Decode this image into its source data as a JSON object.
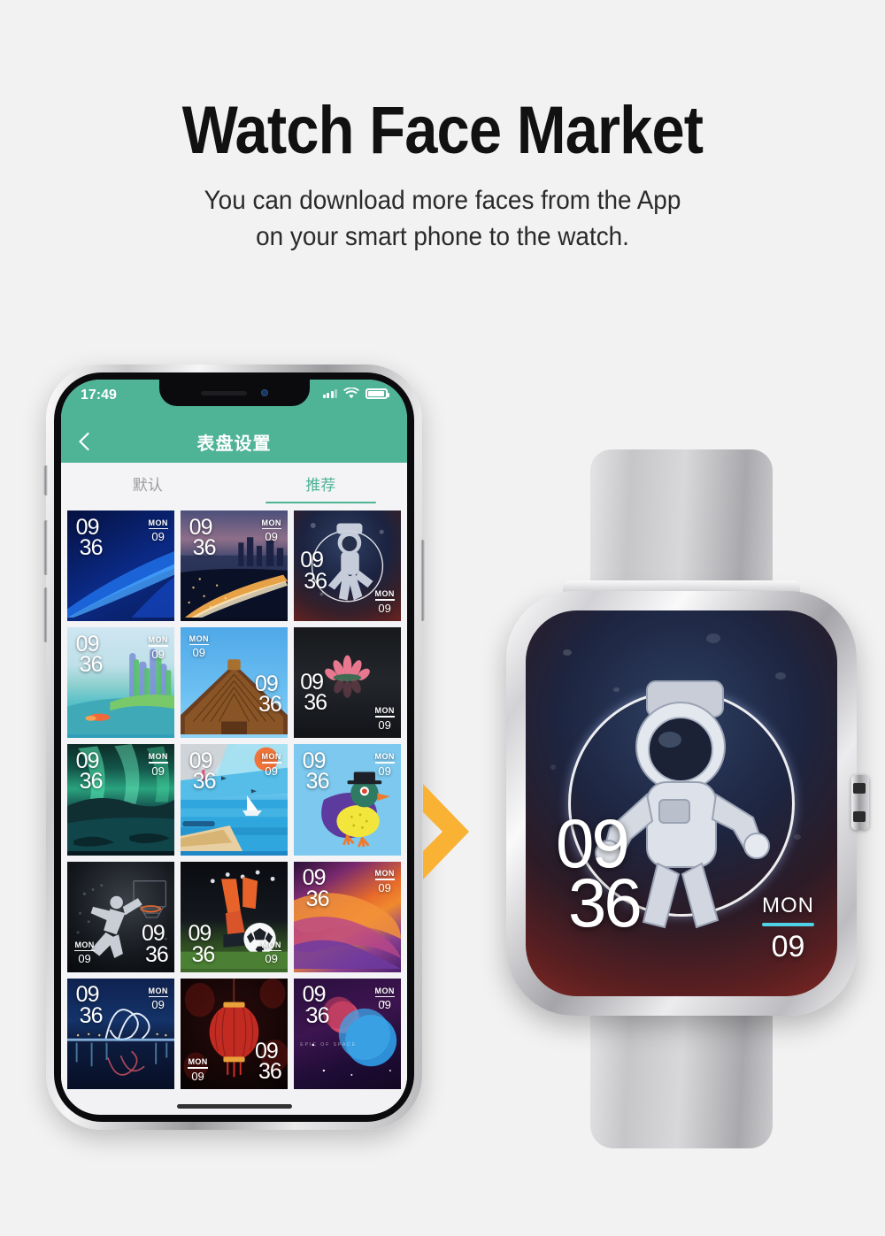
{
  "hero": {
    "title": "Watch Face Market",
    "subtitle_line1": "You can download more faces from the App",
    "subtitle_line2": "on your smart phone to the watch."
  },
  "colors": {
    "page_background": "#f2f2f2",
    "header_green": "#4fb396",
    "arrow_orange": "#f9b233",
    "date_accent_cyan": "#4fd2e6",
    "tab_inactive": "#9b9ba0"
  },
  "phone": {
    "status_bar": {
      "time": "17:49",
      "icons": [
        "signal-icon",
        "wifi-icon",
        "battery-icon"
      ],
      "battery_level": "86"
    },
    "navbar": {
      "back_icon": "chevron-left-icon",
      "title": "表盘设置"
    },
    "tabs": [
      {
        "label": "默认",
        "active": false
      },
      {
        "label": "推荐",
        "active": true
      }
    ],
    "home_indicator": "home-bar"
  },
  "watch_faces": {
    "time_hours": "09",
    "time_minutes": "36",
    "date_weekday": "MON",
    "date_day": "09",
    "tiles": [
      {
        "name": "blue-abstract-waves",
        "time_pos": "tl",
        "date_pos": "tr"
      },
      {
        "name": "city-night-skyline",
        "time_pos": "tl",
        "date_pos": "tr"
      },
      {
        "name": "astronaut-space",
        "time_pos": "ml",
        "date_pos": "br"
      },
      {
        "name": "fantasy-green-island",
        "time_pos": "tl",
        "date_pos": "tr"
      },
      {
        "name": "temple-roof-blue-sky",
        "time_pos": "mr",
        "date_pos": "tl"
      },
      {
        "name": "pink-lotus-dark",
        "time_pos": "cl",
        "date_pos": "br"
      },
      {
        "name": "aurora-northern-lights",
        "time_pos": "tl",
        "date_pos": "tr"
      },
      {
        "name": "sailboat-beach-flat",
        "time_pos": "tl",
        "date_pos": "tr"
      },
      {
        "name": "bird-top-hat-illustration",
        "time_pos": "tl",
        "date_pos": "tr"
      },
      {
        "name": "basketball-dunk",
        "time_pos": "br",
        "date_pos": "bl"
      },
      {
        "name": "soccer-football",
        "time_pos": "bl",
        "date_pos": "br"
      },
      {
        "name": "orange-purple-canyon",
        "time_pos": "tl",
        "date_pos": "tr"
      },
      {
        "name": "bridge-night-reflection",
        "time_pos": "tl",
        "date_pos": "tr"
      },
      {
        "name": "red-lantern-festival",
        "time_pos": "br",
        "date_pos": "bl"
      },
      {
        "name": "space-planets",
        "time_pos": "tl",
        "date_pos": "tr",
        "caption": "EPIC OF SPACE"
      }
    ]
  },
  "watch": {
    "face_name": "astronaut-space",
    "time_hours": "09",
    "time_minutes": "36",
    "date_weekday": "MON",
    "date_day": "09",
    "crown_icon": "crown-button"
  },
  "arrow": {
    "icon": "chevron-right-arrow"
  }
}
